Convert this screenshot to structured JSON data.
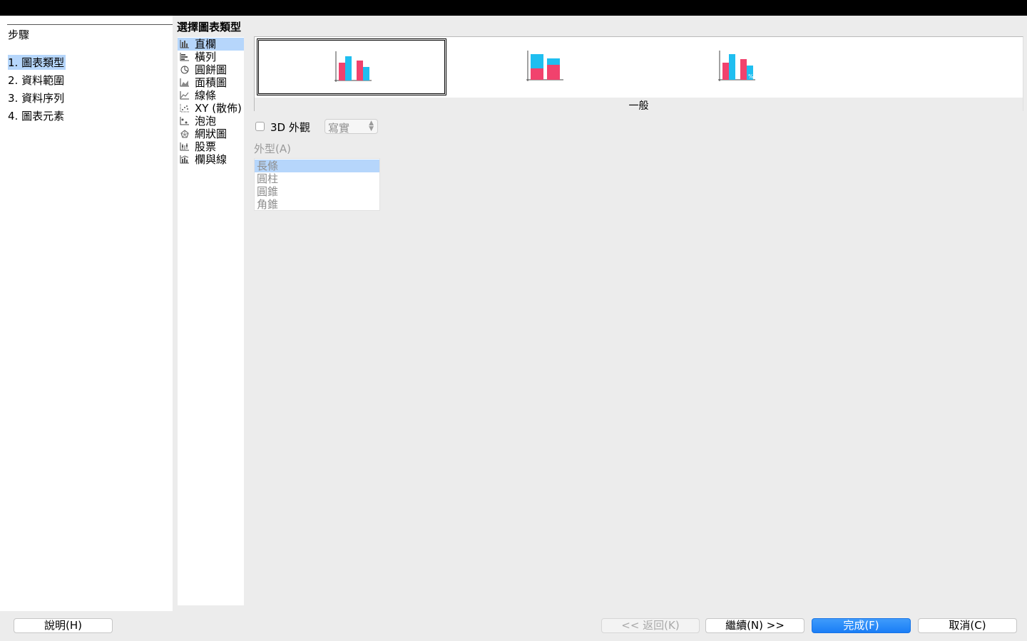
{
  "steps": {
    "title": "步驟",
    "items": [
      {
        "label": "1. 圖表類型",
        "active": true
      },
      {
        "label": "2. 資料範圍",
        "active": false
      },
      {
        "label": "3. 資料序列",
        "active": false
      },
      {
        "label": "4. 圖表元素",
        "active": false
      }
    ]
  },
  "chart_type": {
    "heading": "選擇圖表類型",
    "items": [
      {
        "label": "直欄",
        "icon": "column-chart-icon",
        "selected": true
      },
      {
        "label": "橫列",
        "icon": "bar-chart-icon",
        "selected": false
      },
      {
        "label": "圓餅圖",
        "icon": "pie-chart-icon",
        "selected": false
      },
      {
        "label": "面積圖",
        "icon": "area-chart-icon",
        "selected": false
      },
      {
        "label": "線條",
        "icon": "line-chart-icon",
        "selected": false
      },
      {
        "label": "XY (散佈)",
        "icon": "scatter-chart-icon",
        "selected": false
      },
      {
        "label": "泡泡",
        "icon": "bubble-chart-icon",
        "selected": false
      },
      {
        "label": "網狀圖",
        "icon": "net-chart-icon",
        "selected": false
      },
      {
        "label": "股票",
        "icon": "stock-chart-icon",
        "selected": false
      },
      {
        "label": "欄與線",
        "icon": "column-line-chart-icon",
        "selected": false
      }
    ]
  },
  "preview": {
    "variants": [
      {
        "name": "normal-column",
        "selected": true
      },
      {
        "name": "stacked-column",
        "selected": false
      },
      {
        "name": "percent-stacked-column",
        "selected": false
      }
    ],
    "caption": "一般",
    "percent_mark": "%"
  },
  "options": {
    "look_3d_label": "3D 外觀",
    "look_3d_checked": false,
    "style_value": "寫實",
    "shape_label": "外型(A)",
    "shapes": [
      {
        "label": "長條",
        "selected": true
      },
      {
        "label": "圓柱",
        "selected": false
      },
      {
        "label": "圓錐",
        "selected": false
      },
      {
        "label": "角錐",
        "selected": false
      }
    ]
  },
  "buttons": {
    "help": "說明(H)",
    "back": "<< 返回(K)",
    "next": "繼續(N) >>",
    "finish": "完成(F)",
    "cancel": "取消(C)"
  },
  "colors": {
    "selection": "#b6d6fb",
    "series_pink": "#f1426d",
    "series_blue": "#1fbef0",
    "primary_button": "#1a7ef6"
  }
}
